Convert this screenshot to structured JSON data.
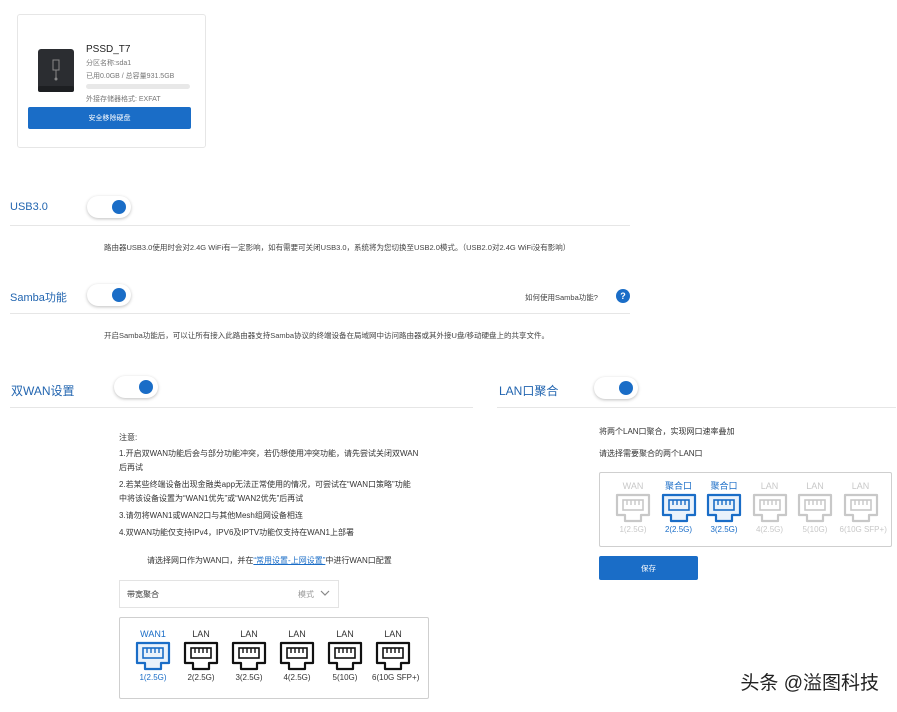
{
  "usb": {
    "name": "PSSD_T7",
    "partition": "分区名称:sda1",
    "capacity": "已用0.0GB / 总容量931.5GB",
    "format": "外接存储器格式: EXFAT",
    "usage_fraction": 0.0,
    "eject_label": "安全移除硬盘"
  },
  "usb3": {
    "label": "USB3.0",
    "enabled": true,
    "desc": "路由器USB3.0使用时会对2.4G WiFi有一定影响，如有需要可关闭USB3.0，系统将为您切换至USB2.0模式。（USB2.0对2.4G WiFi没有影响）"
  },
  "samba": {
    "label": "Samba功能",
    "enabled": true,
    "help_text": "如何使用Samba功能?",
    "help_icon": "?",
    "desc": "开启Samba功能后，可以让所有接入此路由器支持Samba协议的终端设备在局域网中访问路由器或其外接U盘/移动硬盘上的共享文件。"
  },
  "dual_wan": {
    "label": "双WAN设置",
    "enabled": true,
    "notes": [
      "注意:",
      "1.开启双WAN功能后会与部分功能冲突，若仍想使用冲突功能，请先尝试关闭双WAN",
      "后再试",
      "2.若某些终端设备出现金融类app无法正常使用的情况，可尝试在“WAN口策略”功能",
      "中将该设备设置为“WAN1优先”或“WAN2优先”后再试",
      "3.请勿将WAN1或WAN2口与其他Mesh组网设备相连",
      "4.双WAN功能仅支持IPv4，IPV6及IPTV功能仅支持在WAN1上部署"
    ],
    "config_prefix": "请选择网口作为WAN口，并在",
    "config_link": "“常用设置-上网设置”",
    "config_suffix": "中进行WAN口配置",
    "select_value": "带宽聚合",
    "select_mode": "模式",
    "ports": [
      {
        "top": "WAN1",
        "bottom": "1(2.5G)",
        "state": "selected"
      },
      {
        "top": "LAN",
        "bottom": "2(2.5G)",
        "state": "normal"
      },
      {
        "top": "LAN",
        "bottom": "3(2.5G)",
        "state": "normal"
      },
      {
        "top": "LAN",
        "bottom": "4(2.5G)",
        "state": "normal"
      },
      {
        "top": "LAN",
        "bottom": "5(10G)",
        "state": "normal"
      },
      {
        "top": "LAN",
        "bottom": "6(10G SFP+)",
        "state": "normal"
      }
    ]
  },
  "lan_agg": {
    "label": "LAN口聚合",
    "enabled": true,
    "desc1": "将两个LAN口聚合，实现网口速率叠加",
    "desc2": "请选择需要聚合的两个LAN口",
    "ports": [
      {
        "top": "WAN",
        "bottom": "1(2.5G)",
        "state": "disabled"
      },
      {
        "top": "聚合口",
        "bottom": "2(2.5G)",
        "state": "selected"
      },
      {
        "top": "聚合口",
        "bottom": "3(2.5G)",
        "state": "selected"
      },
      {
        "top": "LAN",
        "bottom": "4(2.5G)",
        "state": "disabled"
      },
      {
        "top": "LAN",
        "bottom": "5(10G)",
        "state": "disabled"
      },
      {
        "top": "LAN",
        "bottom": "6(10G SFP+)",
        "state": "disabled"
      }
    ],
    "save_label": "保存"
  },
  "watermark": "头条 @溢图科技",
  "colors": {
    "accent": "#1a6dc7",
    "text": "#333333",
    "disabled": "#c8c8c8"
  }
}
